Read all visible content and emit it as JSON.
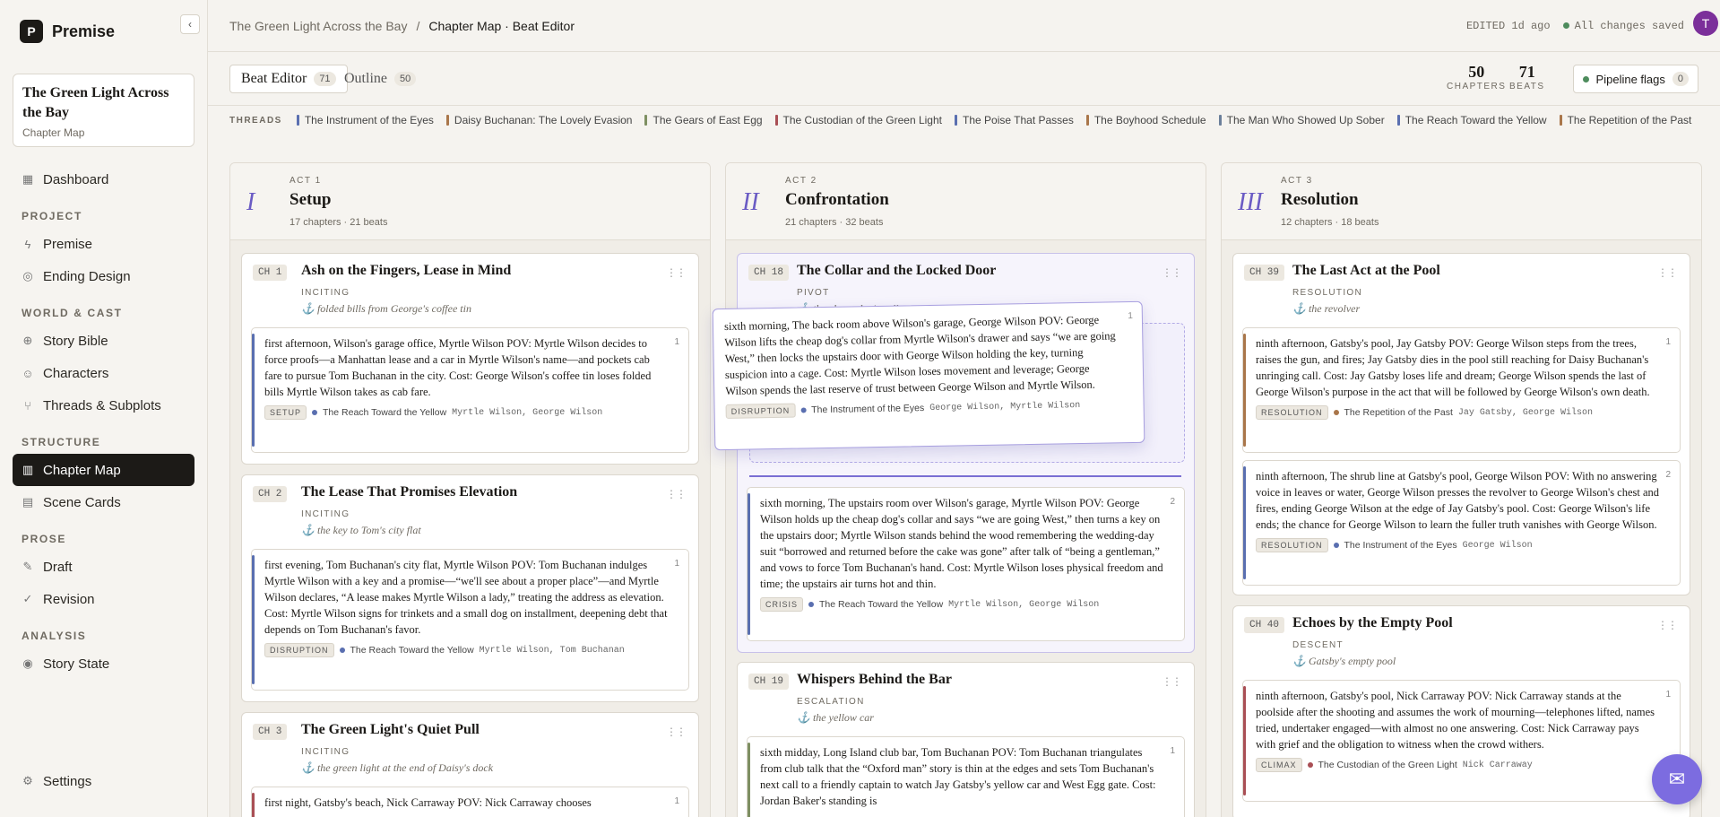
{
  "app": {
    "name": "Premise",
    "logo_letter": "P"
  },
  "project": {
    "title": "The Green Light Across the Bay",
    "subtitle": "Chapter Map"
  },
  "nav": {
    "dashboard": "Dashboard",
    "sections": [
      {
        "label": "PROJECT",
        "items": [
          "Premise",
          "Ending Design"
        ]
      },
      {
        "label": "WORLD & CAST",
        "items": [
          "Story Bible",
          "Characters",
          "Threads & Subplots"
        ]
      },
      {
        "label": "STRUCTURE",
        "items": [
          "Chapter Map",
          "Scene Cards"
        ]
      },
      {
        "label": "PROSE",
        "items": [
          "Draft",
          "Revision"
        ]
      },
      {
        "label": "ANALYSIS",
        "items": [
          "Story State"
        ]
      }
    ],
    "settings": "Settings"
  },
  "breadcrumb": {
    "root": "The Green Light Across the Bay",
    "sep": "/",
    "current": "Chapter Map · Beat Editor"
  },
  "status": {
    "edited": "EDITED 1d ago",
    "saved": "All changes saved",
    "avatar": "T"
  },
  "tabs": [
    {
      "label": "Beat Editor",
      "count": "71"
    },
    {
      "label": "Outline",
      "count": "50"
    }
  ],
  "stats": [
    {
      "n": "50",
      "label": "CHAPTERS"
    },
    {
      "n": "71",
      "label": "BEATS"
    }
  ],
  "flags": {
    "label": "Pipeline flags",
    "count": "0"
  },
  "threads_label": "THREADS",
  "threads": [
    {
      "name": "The Instrument of the Eyes",
      "color": "#5a6fb0"
    },
    {
      "name": "Daisy Buchanan: The Lovely Evasion",
      "color": "#a9764a"
    },
    {
      "name": "The Gears of East Egg",
      "color": "#7e8f62"
    },
    {
      "name": "The Custodian of the Green Light",
      "color": "#a94f55"
    },
    {
      "name": "The Poise That Passes",
      "color": "#5a6fb0"
    },
    {
      "name": "The Boyhood Schedule",
      "color": "#a9764a"
    },
    {
      "name": "The Man Who Showed Up Sober",
      "color": "#6b7f9a"
    },
    {
      "name": "The Reach Toward the Yellow",
      "color": "#5a6fb0"
    },
    {
      "name": "The Repetition of the Past",
      "color": "#a9764a"
    }
  ],
  "acts": [
    {
      "roman": "I",
      "act": "ACT 1",
      "title": "Setup",
      "meta": "17 chapters · 21 beats"
    },
    {
      "roman": "II",
      "act": "ACT 2",
      "title": "Confrontation",
      "meta": "21 chapters · 32 beats"
    },
    {
      "roman": "III",
      "act": "ACT 3",
      "title": "Resolution",
      "meta": "12 chapters · 18 beats"
    }
  ],
  "act1": {
    "ch1": {
      "badge": "CH 1",
      "title": "Ash on the Fingers, Lease in Mind",
      "type": "INCITING",
      "anchor": "folded bills from George's coffee tin",
      "beat": {
        "num": "1",
        "text": "first afternoon, Wilson's garage office, Myrtle Wilson POV: Myrtle Wilson decides to force proofs—a Manhattan lease and a car in Myrtle Wilson's name—and pockets cab fare to pursue Tom Buchanan in the city. Cost: George Wilson's coffee tin loses folded bills Myrtle Wilson takes as cab fare.",
        "tag": "SETUP",
        "thread": "The Reach Toward the Yellow",
        "chars": "Myrtle Wilson, George Wilson"
      }
    },
    "ch2": {
      "badge": "CH 2",
      "title": "The Lease That Promises Elevation",
      "type": "INCITING",
      "anchor": "the key to Tom's city flat",
      "beat": {
        "num": "1",
        "text": "first evening, Tom Buchanan's city flat, Myrtle Wilson POV: Tom Buchanan indulges Myrtle Wilson with a key and a promise—“we'll see about a proper place”—and Myrtle Wilson declares, “A lease makes Myrtle Wilson a lady,” treating the address as elevation. Cost: Myrtle Wilson signs for trinkets and a small dog on installment, deepening debt that depends on Tom Buchanan's favor.",
        "tag": "DISRUPTION",
        "thread": "The Reach Toward the Yellow",
        "chars": "Myrtle Wilson, Tom Buchanan"
      }
    },
    "ch3": {
      "badge": "CH 3",
      "title": "The Green Light's Quiet Pull",
      "type": "INCITING",
      "anchor": "the green light at the end of Daisy's dock",
      "beat": {
        "num": "1",
        "text": "first night, Gatsby's beach, Nick Carraway POV: Nick Carraway chooses"
      }
    }
  },
  "act2": {
    "ch18": {
      "badge": "CH 18",
      "title": "The Collar and the Locked Door",
      "type": "PIVOT",
      "anchor": "the cheap dog's collar",
      "ghost": {
        "num": "1",
        "text": "sixth morning, The back room above Wilson's garage, George Wilson POV: George Wilson lifts the cheap dog's collar from Myrtle Wilson's drawer and says “we are going West,” then locks the upstairs door with George Wilson holding the key, turning suspicion into a cage. Cost: Myrtle Wilson loses movement and leverage; George Wilson spends the last reserve of trust between George Wilson and Myrtle Wilson.",
        "tag": "DISRUPTION",
        "thread": "The Instrument of the Eyes",
        "chars": "George Wilson, Myrtle Wilson"
      },
      "beat2": {
        "num": "2",
        "text": "sixth morning, The upstairs room over Wilson's garage, Myrtle Wilson POV: George Wilson holds up the cheap dog's collar and says “we are going West,” then turns a key on the upstairs door; Myrtle Wilson stands behind the wood remembering the wedding-day suit “borrowed and returned before the cake was gone” after talk of “being a gentleman,” and vows to force Tom Buchanan's hand. Cost: Myrtle Wilson loses physical freedom and time; the upstairs air turns hot and thin.",
        "tag": "CRISIS",
        "thread": "The Reach Toward the Yellow",
        "chars": "Myrtle Wilson, George Wilson"
      }
    },
    "ch19": {
      "badge": "CH 19",
      "title": "Whispers Behind the Bar",
      "type": "ESCALATION",
      "anchor": "the yellow car",
      "beat": {
        "num": "1",
        "text": "sixth midday, Long Island club bar, Tom Buchanan POV: Tom Buchanan triangulates from club talk that the “Oxford man” story is thin at the edges and sets Tom Buchanan's next call to a friendly captain to watch Jay Gatsby's yellow car and West Egg gate. Cost: Jordan Baker's standing is"
      }
    }
  },
  "act3": {
    "ch39": {
      "badge": "CH 39",
      "title": "The Last Act at the Pool",
      "type": "RESOLUTION",
      "anchor": "the revolver",
      "beat1": {
        "num": "1",
        "text": "ninth afternoon, Gatsby's pool, Jay Gatsby POV: George Wilson steps from the trees, raises the gun, and fires; Jay Gatsby dies in the pool still reaching for Daisy Buchanan's unringing call. Cost: Jay Gatsby loses life and dream; George Wilson spends the last of George Wilson's purpose in the act that will be followed by George Wilson's own death.",
        "tag": "RESOLUTION",
        "thread": "The Repetition of the Past",
        "chars": "Jay Gatsby, George Wilson"
      },
      "beat2": {
        "num": "2",
        "text": "ninth afternoon, The shrub line at Gatsby's pool, George Wilson POV: With no answering voice in leaves or water, George Wilson presses the revolver to George Wilson's chest and fires, ending George Wilson at the edge of Jay Gatsby's pool. Cost: George Wilson's life ends; the chance for George Wilson to learn the fuller truth vanishes with George Wilson.",
        "tag": "RESOLUTION",
        "thread": "The Instrument of the Eyes",
        "chars": "George Wilson"
      }
    },
    "ch40": {
      "badge": "CH 40",
      "title": "Echoes by the Empty Pool",
      "type": "DESCENT",
      "anchor": "Gatsby's empty pool",
      "beat": {
        "num": "1",
        "text": "ninth afternoon, Gatsby's pool, Nick Carraway POV: Nick Carraway stands at the poolside after the shooting and assumes the work of mourning—telephones lifted, names tried, undertaker engaged—with almost no one answering. Cost: Nick Carraway pays with grief and the obligation to witness when the crowd withers.",
        "tag": "CLIMAX",
        "thread": "The Custodian of the Green Light",
        "chars": "Nick Carraway"
      }
    }
  }
}
